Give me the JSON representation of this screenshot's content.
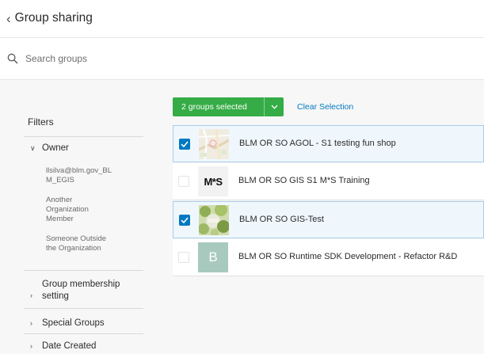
{
  "header": {
    "title": "Group sharing",
    "back_glyph": "‹"
  },
  "search": {
    "placeholder": "Search groups",
    "value": ""
  },
  "filters": {
    "heading": "Filters",
    "owner": {
      "label": "Owner",
      "expanded": true,
      "options": [
        "llsilva@blm.gov_BL M_EGIS",
        "Another Organization Member",
        "Someone Outside the Organization"
      ]
    },
    "sections": [
      "Group membership setting",
      "Special Groups",
      "Date Created"
    ]
  },
  "toolbar": {
    "selection_label": "2 groups selected",
    "clear_label": "Clear Selection"
  },
  "groups": [
    {
      "title": "BLM OR SO AGOL - S1 testing fun shop",
      "checked": true,
      "thumbnail": "map-thumbnail"
    },
    {
      "title": "BLM OR SO GIS S1 M*S Training",
      "checked": false,
      "thumbnail": "text-logo",
      "thumb_text": "M*S"
    },
    {
      "title": "BLM OR SO GIS-Test",
      "checked": true,
      "thumbnail": "photo-thumbnail"
    },
    {
      "title": "BLM OR SO Runtime SDK Development - Refactor R&D",
      "checked": false,
      "thumbnail": "letter-avatar",
      "thumb_text": "B"
    }
  ],
  "colors": {
    "accent_blue": "#0079c1",
    "selection_green": "#35ac46",
    "selected_row_bg": "#f0f7fc",
    "letter_avatar_bg": "#a8cabe"
  }
}
